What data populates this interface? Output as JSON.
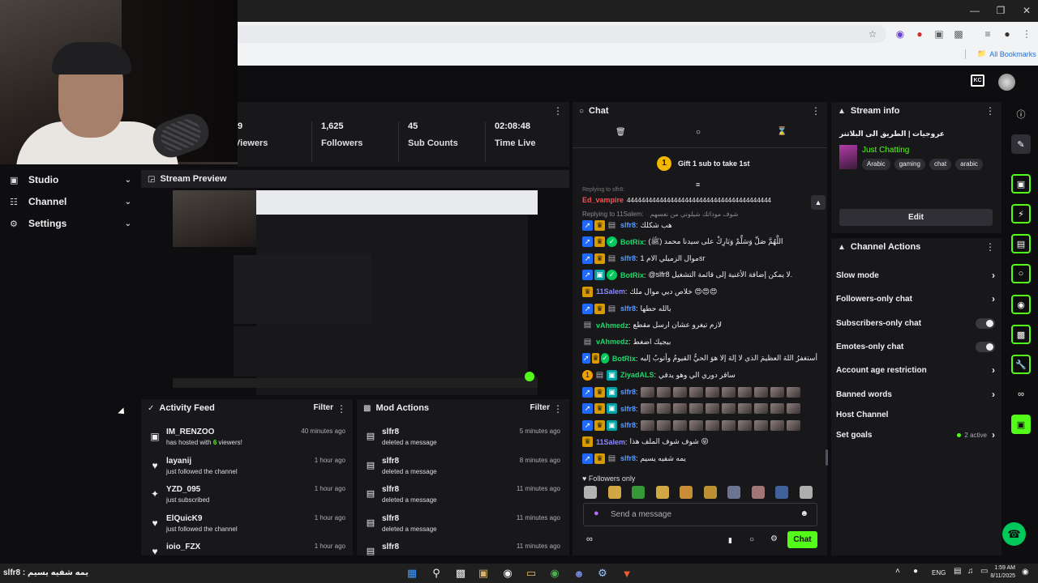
{
  "browser": {
    "bookmarks_label": "All Bookmarks"
  },
  "nav": {
    "items": [
      {
        "label": "Studio"
      },
      {
        "label": "Channel"
      },
      {
        "label": "Settings"
      }
    ]
  },
  "stats": {
    "viewers_value": "9",
    "viewers_label": "Viewers",
    "followers_value": "1,625",
    "followers_label": "Followers",
    "subs_value": "45",
    "subs_label": "Sub Counts",
    "time_value": "02:08:48",
    "time_label": "Time Live"
  },
  "preview": {
    "title": "Stream Preview"
  },
  "activity": {
    "title": "Activity Feed",
    "filter": "Filter",
    "items": [
      {
        "icon": "host-icon",
        "name": "IM_RENZOO",
        "sub_pre": "has hosted with ",
        "sub_num": "6",
        "sub_post": " viewers!",
        "time": "40 minutes ago"
      },
      {
        "icon": "heart-icon",
        "name": "layanij",
        "sub": "just followed the channel",
        "time": "1 hour ago"
      },
      {
        "icon": "star-icon",
        "name": "YZD_095",
        "sub": "just subscribed",
        "time": "1 hour ago"
      },
      {
        "icon": "heart-icon",
        "name": "ElQuicK9",
        "sub": "just followed the channel",
        "time": "1 hour ago"
      },
      {
        "icon": "heart-icon",
        "name": "ioio_FZX",
        "sub": "",
        "time": "1 hour ago"
      }
    ]
  },
  "mod_actions": {
    "title": "Mod Actions",
    "filter": "Filter",
    "items": [
      {
        "name": "slfr8",
        "sub": "deleted a message",
        "time": "5 minutes ago"
      },
      {
        "name": "slfr8",
        "sub": "deleted a message",
        "time": "8 minutes ago"
      },
      {
        "name": "slfr8",
        "sub": "deleted a message",
        "time": "11 minutes ago"
      },
      {
        "name": "slfr8",
        "sub": "deleted a message",
        "time": "11 minutes ago"
      },
      {
        "name": "slfr8",
        "sub": "",
        "time": "11 minutes ago"
      }
    ]
  },
  "chat": {
    "title": "Chat",
    "gift_rank": "1",
    "gift_text": "Gift 1 sub to take 1st",
    "replying_top": "Replying to slfr8:",
    "ed_user": "Ed_vampire",
    "ed_text": "4444444444444444444444444444444444444444",
    "replying_11": "Replying to 11Salem:",
    "replying_11_text": "شوف موداتك شيلوني من نفسهم",
    "messages": [
      {
        "badges": [
          "b-blue",
          "b-gold",
          "b-gray"
        ],
        "user": "slfr8",
        "color": "#5b9bff",
        "text": "هب شكلك"
      },
      {
        "badges": [
          "b-blue",
          "b-gold",
          "b-green"
        ],
        "user": "BotRix",
        "color": "#1bd96a",
        "text": "اللَّهُمَّ صَلِّ وَسَلِّمْ وَبَارِكْ على سيدنا محمد (ﷺ)"
      },
      {
        "badges": [
          "b-blue",
          "b-gold",
          "b-gray"
        ],
        "user": "slfr8",
        "color": "#5b9bff",
        "text": "موال الزميلي الام 1sr"
      },
      {
        "badges": [
          "b-blue",
          "b-teal",
          "b-green"
        ],
        "user": "BotRix",
        "color": "#1bd96a",
        "text": "@slfr8 لا يمكن إضافة الأغنية إلى قائمة التشغيل."
      },
      {
        "badges": [
          "b-gold"
        ],
        "user": "11Salem",
        "color": "#8b86ff",
        "text": "خلاص ديي موال ملك 😍😍😍"
      },
      {
        "badges": [
          "b-blue",
          "b-gold",
          "b-gray"
        ],
        "user": "slfr8",
        "color": "#5b9bff",
        "text": "بالله حطها"
      },
      {
        "badges": [
          "b-gray"
        ],
        "user": "vAhmedz",
        "color": "#1bd96a",
        "text": "لازم تيغرو عشان ارسل مقطع"
      },
      {
        "badges": [
          "b-gray"
        ],
        "user": "vAhmedz",
        "color": "#1bd96a",
        "text": "بيجيك اضغط"
      },
      {
        "badges": [
          "b-blue",
          "b-gold",
          "b-green"
        ],
        "user": "BotRix",
        "color": "#1bd96a",
        "text": "أستغفرُ اللهَ العظيمَ الذي لا إلهَ إلا هوَ الحيُّ القيومُ وأتوبُ إليه"
      },
      {
        "badges": [
          "b-orange",
          "b-gray",
          "b-teal"
        ],
        "user": "ZiyadALS",
        "color": "#1bd96a",
        "text": "ساقر دوري الي وهو يدقي"
      },
      {
        "badges": [
          "b-blue",
          "b-gold",
          "b-teal"
        ],
        "user": "slfr8",
        "color": "#5b9bff",
        "text": ""
      },
      {
        "badges": [
          "b-blue",
          "b-gold",
          "b-teal"
        ],
        "user": "slfr8",
        "color": "#5b9bff",
        "text": ""
      },
      {
        "badges": [
          "b-blue",
          "b-gold",
          "b-teal"
        ],
        "user": "slfr8",
        "color": "#5b9bff",
        "text": ""
      },
      {
        "badges": [
          "b-gold"
        ],
        "user": "11Salem",
        "color": "#8b86ff",
        "text": "شوف شوف الملف هذا 😝"
      },
      {
        "badges": [
          "b-blue",
          "b-gold",
          "b-gray"
        ],
        "user": "slfr8",
        "color": "#5b9bff",
        "text": "يمه شفيه يسيم"
      }
    ],
    "followers_only": "Followers only",
    "input_placeholder": "Send a message",
    "send_label": "Chat"
  },
  "stream_info": {
    "title": "Stream info",
    "stream_title": "عروجيات | الطريق الى البلاتنر",
    "category": "Just Chatting",
    "tags": [
      "Arabic",
      "gaming",
      "chat",
      "arabic"
    ],
    "edit_label": "Edit"
  },
  "channel_actions": {
    "title": "Channel Actions",
    "items": [
      {
        "label": "Slow mode",
        "control": "chevron"
      },
      {
        "label": "Followers-only chat",
        "control": "chevron"
      },
      {
        "label": "Subscribers-only chat",
        "control": "toggle"
      },
      {
        "label": "Emotes-only chat",
        "control": "toggle"
      },
      {
        "label": "Account age restriction",
        "control": "chevron"
      },
      {
        "label": "Banned words",
        "control": "chevron"
      },
      {
        "label": "Host Channel",
        "control": "none"
      },
      {
        "label": "Set goals",
        "control": "chevron",
        "status": "2 active"
      }
    ]
  },
  "taskbar": {
    "window_title": "يمه شفيه يسيم : slfr8",
    "lang": "ENG",
    "time": "1:59 AM",
    "date": "8/11/2025"
  },
  "colors": {
    "accent_green": "#53fc18",
    "brand_gold": "#f3b700",
    "panel_bg": "#18181b"
  }
}
